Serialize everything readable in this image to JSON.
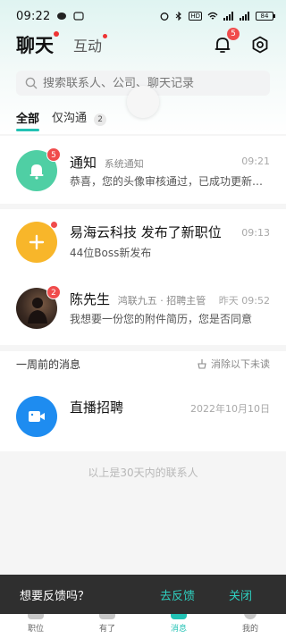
{
  "status_bar": {
    "time": "09:22",
    "network_labels": "HD",
    "battery": "84"
  },
  "header": {
    "tab_chat": "聊天",
    "tab_interact": "互动",
    "bell_badge": "5"
  },
  "search": {
    "placeholder": "搜索联系人、公司、聊天记录"
  },
  "filters": {
    "all": "全部",
    "only": "仅沟通",
    "only_count": "2"
  },
  "conversations": [
    {
      "title": "通知",
      "subtitle": "系统通知",
      "time": "09:21",
      "message": "恭喜，您的头像审核通过，已成功更新…",
      "badge": "5",
      "avatar_color": "#4fcfa4",
      "icon": "bell-icon"
    },
    {
      "title": "易海云科技 发布了新职位",
      "subtitle": "",
      "time": "09:13",
      "message": "44位Boss新发布",
      "avatar_color": "#f8b62a",
      "icon": "plus-icon"
    },
    {
      "title": "陈先生",
      "subtitle": "鸿联九五 · 招聘主管",
      "time": "昨天 09:52",
      "message": "我想要一份您的附件简历，您是否同意",
      "badge": "2",
      "avatar_color": "#3a2a22",
      "icon": "avatar-photo"
    },
    {
      "title": "直播招聘",
      "subtitle": "",
      "time": "2022年10月10日",
      "message": "",
      "avatar_color": "#1e8cf0",
      "icon": "video-camera-icon"
    }
  ],
  "section": {
    "week_ago": "一周前的消息",
    "clear_unread": "消除以下未读"
  },
  "footer_note": "以上是30天内的联系人",
  "feedback": {
    "prompt": "想要反馈吗？",
    "go": "去反馈",
    "close": "关闭"
  },
  "tabbar": {
    "items": [
      "职位",
      "有了",
      "消息",
      "我的"
    ]
  },
  "colors": {
    "accent": "#22c2b4",
    "badge": "#f04c4c"
  }
}
